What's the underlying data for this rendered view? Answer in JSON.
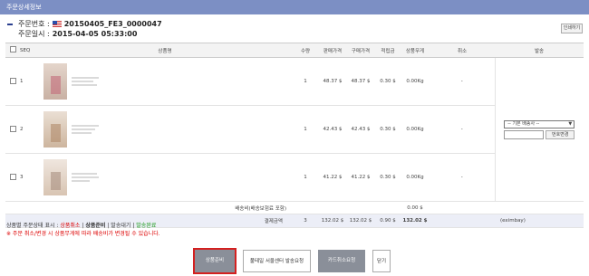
{
  "window": {
    "title": "주문상세정보"
  },
  "order": {
    "number_label": "주문번호 :",
    "number": "20150405_FE3_0000047",
    "date_label": "주문일시 :",
    "date": "2015-04-05 05:33:00"
  },
  "toolbar": {
    "print_label": "인쇄하기"
  },
  "table": {
    "headers": {
      "seq": "SEQ",
      "product": "상품명",
      "qty": "수량",
      "sale_price": "판매가격",
      "purchase_price": "구매가격",
      "points": "적립금",
      "weight": "상품무게",
      "cancel": "취소",
      "shipping": "발송"
    },
    "rows": [
      {
        "seq": "1",
        "qty": "1",
        "sale_price": "48.37 $",
        "purchase_price": "48.37 $",
        "points": "0.30 $",
        "weight": "0.00Kg",
        "cancel": "-"
      },
      {
        "seq": "2",
        "qty": "1",
        "sale_price": "42.43 $",
        "purchase_price": "42.43 $",
        "points": "0.30 $",
        "weight": "0.00Kg",
        "cancel": "-"
      },
      {
        "seq": "3",
        "qty": "1",
        "sale_price": "41.22 $",
        "purchase_price": "41.22 $",
        "points": "0.30 $",
        "weight": "0.00Kg",
        "cancel": "-"
      }
    ],
    "shipping_fee": {
      "label": "배송비(배송보험료 포함)",
      "value": "0.00 $"
    },
    "total": {
      "label": "결제금액",
      "qty": "3",
      "sale_price": "132.02 $",
      "purchase_price": "132.02 $",
      "points": "0.90 $",
      "amount": "132.02 $",
      "payment_method": "(eximbay)"
    }
  },
  "shipping": {
    "carrier_select": "-- 기본 배송사 --",
    "change_button": "번호변경"
  },
  "legend": {
    "prefix": "상품별 주문상태 표시 :",
    "cancel": "상품취소",
    "sep": "|",
    "prepare": "상품준비",
    "waiting": "발송대기",
    "done": "발송완료"
  },
  "note": "※ 주문 취소/변경 시 상품무게에 따라 배송비가 변경될 수 있습니다.",
  "buttons": {
    "prepare": "상품준비",
    "request_seoul": "풀테일 서울센터 발송요청",
    "card_cancel": "카드취소요청",
    "close": "닫기"
  },
  "colors": {
    "title_bar": "#7c8fc4",
    "accent_red": "#d00000",
    "total_row": "#eceef7",
    "button_gray": "#8a8f99"
  }
}
